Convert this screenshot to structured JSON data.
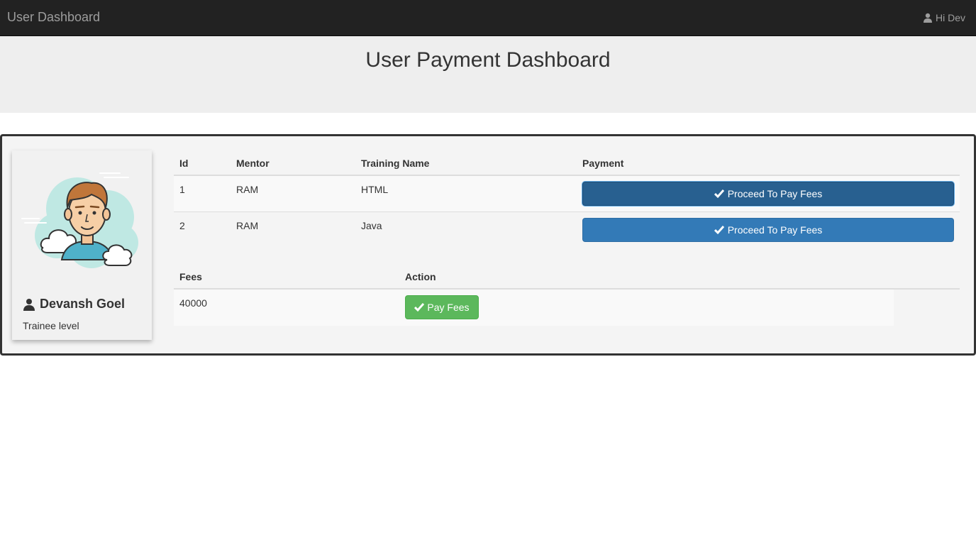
{
  "navbar": {
    "brand": "User Dashboard",
    "greeting": "Hi Dev",
    "user_icon": "user-icon"
  },
  "header": {
    "title": "User Payment Dashboard"
  },
  "profile": {
    "avatar": "cartoon-man-avatar",
    "name": "Devansh Goel",
    "level": "Trainee level"
  },
  "trainings": {
    "columns": [
      "Id",
      "Mentor",
      "Training Name",
      "Payment"
    ],
    "rows": [
      {
        "id": "1",
        "mentor": "RAM",
        "training": "HTML",
        "button": "Proceed To Pay Fees"
      },
      {
        "id": "2",
        "mentor": "RAM",
        "training": "Java",
        "button": "Proceed To Pay Fees"
      }
    ]
  },
  "fees": {
    "columns": [
      "Fees",
      "Action"
    ],
    "rows": [
      {
        "amount": "40000",
        "button": "Pay Fees"
      }
    ]
  },
  "colors": {
    "navbar": "#222222",
    "primary": "#337ab7",
    "success": "#5cb85c",
    "jumbotron": "#eeeeee"
  }
}
